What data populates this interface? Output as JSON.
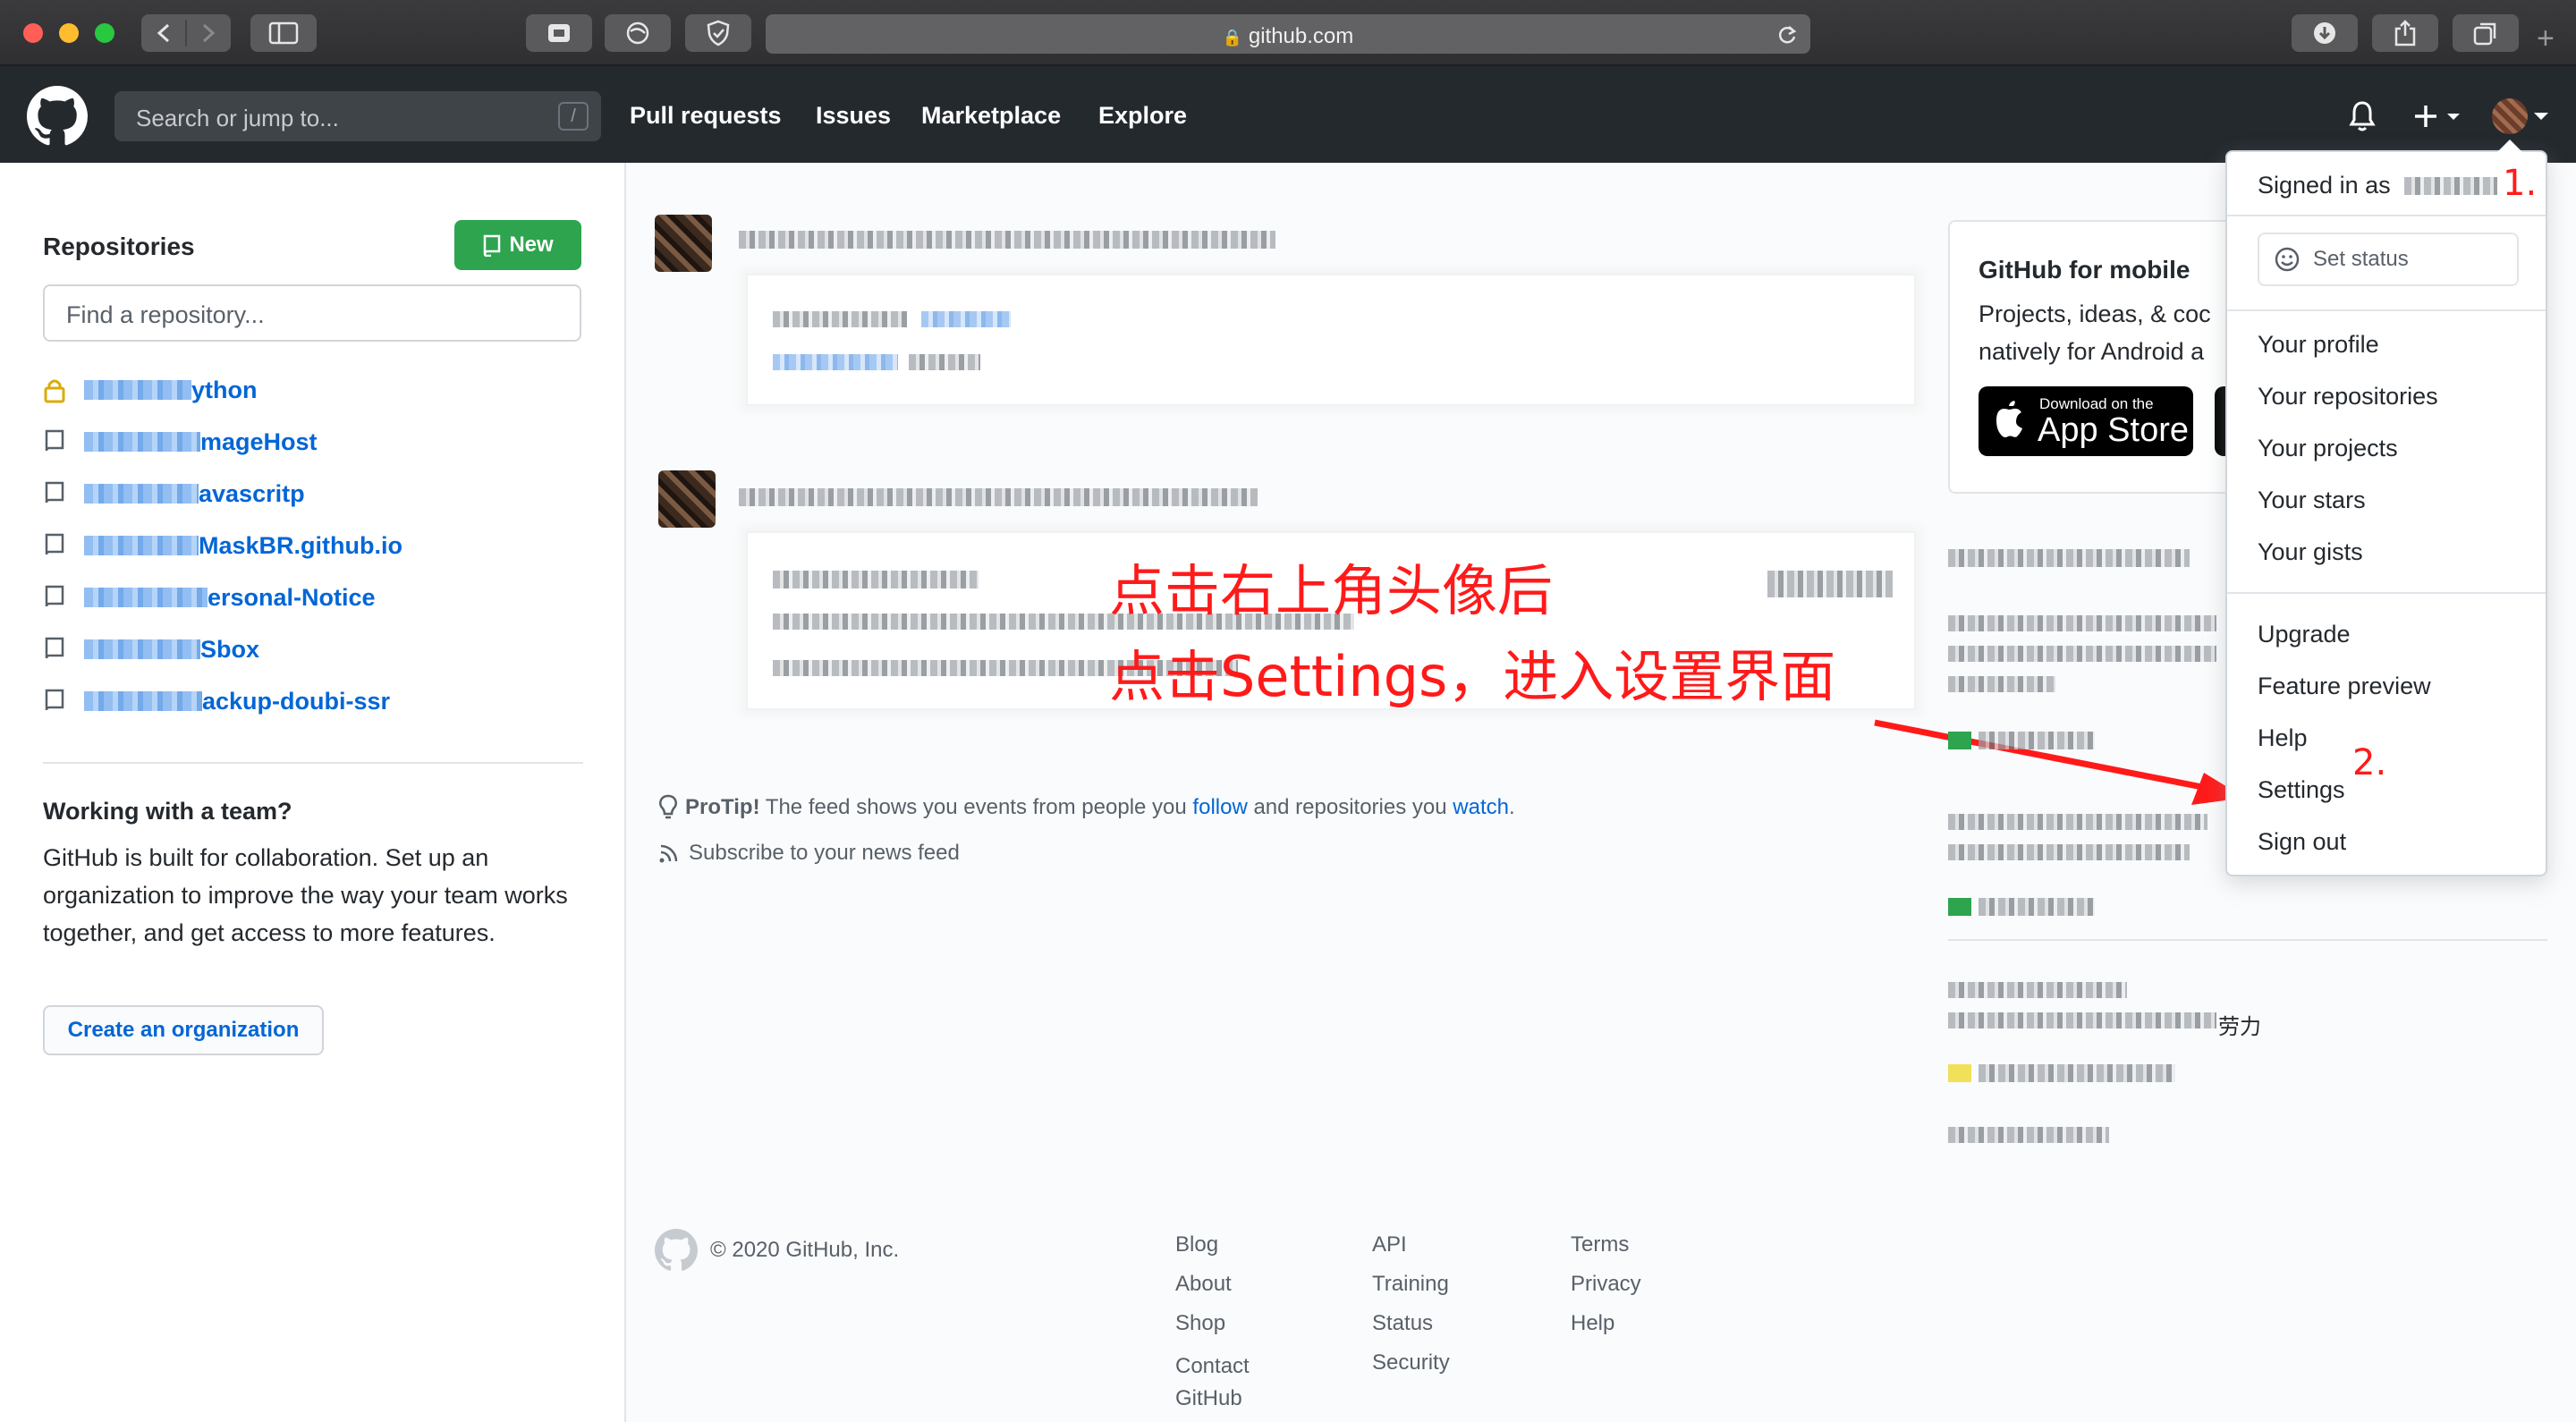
{
  "browser": {
    "url": "github.com",
    "colors": {
      "close": "#ff5f57",
      "minimize": "#febc2e",
      "maximize": "#28c840"
    }
  },
  "header": {
    "search_placeholder": "Search or jump to...",
    "search_shortcut": "/",
    "nav": [
      "Pull requests",
      "Issues",
      "Marketplace",
      "Explore"
    ]
  },
  "sidebar": {
    "repositories_heading": "Repositories",
    "new_button": "New",
    "find_placeholder": "Find a repository...",
    "repos": [
      {
        "name": "ython",
        "private": true
      },
      {
        "name": "mageHost",
        "private": false
      },
      {
        "name": "avascritp",
        "private": false
      },
      {
        "name": "MaskBR.github.io",
        "private": false
      },
      {
        "name": "ersonal-Notice",
        "private": false
      },
      {
        "name": "Sbox",
        "private": false
      },
      {
        "name": "ackup-doubi-ssr",
        "private": false
      }
    ],
    "team_heading": "Working with a team?",
    "team_text": "GitHub is built for collaboration. Set up an organization to improve the way your team works together, and get access to more features.",
    "create_org": "Create an organization"
  },
  "feed": {
    "protip_label": "ProTip!",
    "protip_text_1": "The feed shows you events from people you",
    "protip_follow": "follow",
    "protip_text_2": "and repositories you",
    "protip_watch": "watch",
    "protip_end": ".",
    "subscribe": "Subscribe to your news feed"
  },
  "annotation": {
    "line1": "点击右上角头像后",
    "line2": "点击Settings，进入设置界面",
    "step1": "1.",
    "step2": "2.",
    "color": "#ff1a1a"
  },
  "mobile": {
    "title": "GitHub for mobile",
    "text_1": "Projects, ideas, & coc",
    "text_2": "natively for Android a",
    "appstore_small": "Download on the",
    "appstore_big": "App Store"
  },
  "right_feed": {
    "trailing_text": "劳力"
  },
  "dropdown": {
    "signed_in_as": "Signed in as",
    "set_status": "Set status",
    "group1": [
      "Your profile",
      "Your repositories",
      "Your projects",
      "Your stars",
      "Your gists"
    ],
    "group2": [
      "Upgrade",
      "Feature preview",
      "Help",
      "Settings",
      "Sign out"
    ]
  },
  "footer": {
    "copyright": "© 2020 GitHub, Inc.",
    "col1": [
      "Blog",
      "About",
      "Shop",
      "Contact GitHub"
    ],
    "col2": [
      "API",
      "Training",
      "Status",
      "Security"
    ],
    "col3": [
      "Terms",
      "Privacy",
      "Help"
    ]
  }
}
